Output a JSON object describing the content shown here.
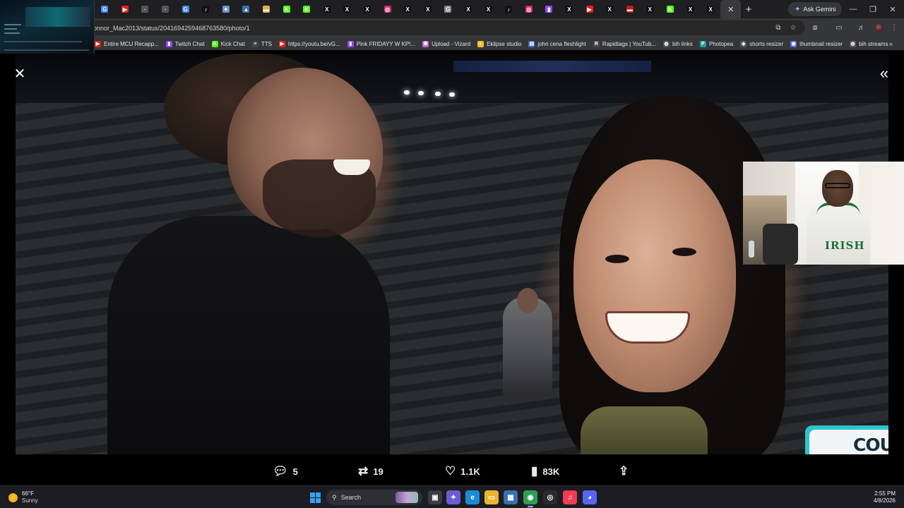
{
  "browser": {
    "tabs": [
      {
        "icon": "chrome-icon",
        "color": "#4285f4",
        "glyph": "G"
      },
      {
        "icon": "youtube-icon",
        "color": "#e62117",
        "glyph": "▶"
      },
      {
        "icon": "tab-icon",
        "color": "#555",
        "glyph": "·"
      },
      {
        "icon": "tab-icon",
        "color": "#555",
        "glyph": "·"
      },
      {
        "icon": "chrome-icon",
        "color": "#4285f4",
        "glyph": "G"
      },
      {
        "icon": "tiktok-icon",
        "color": "#111",
        "glyph": "♪"
      },
      {
        "icon": "twitch-icon",
        "color": "#6e8fd8",
        "glyph": "✦"
      },
      {
        "icon": "tab-icon",
        "color": "#3a6fb0",
        "glyph": "▲"
      },
      {
        "icon": "tab-icon",
        "color": "#d9b24a",
        "glyph": "▬"
      },
      {
        "icon": "kick-icon",
        "color": "#53fc18",
        "glyph": "K"
      },
      {
        "icon": "kick-icon",
        "color": "#53fc18",
        "glyph": "K"
      },
      {
        "icon": "x-icon",
        "color": "#111",
        "glyph": "X"
      },
      {
        "icon": "x-icon",
        "color": "#111",
        "glyph": "X"
      },
      {
        "icon": "x-icon",
        "color": "#111",
        "glyph": "X"
      },
      {
        "icon": "instagram-icon",
        "color": "#d62976",
        "glyph": "◎"
      },
      {
        "icon": "x-icon",
        "color": "#111",
        "glyph": "X"
      },
      {
        "icon": "x-icon",
        "color": "#111",
        "glyph": "X"
      },
      {
        "icon": "chrome-icon",
        "color": "#888",
        "glyph": "G"
      },
      {
        "icon": "x-icon",
        "color": "#111",
        "glyph": "X"
      },
      {
        "icon": "x-icon",
        "color": "#111",
        "glyph": "X"
      },
      {
        "icon": "tiktok-icon",
        "color": "#111",
        "glyph": "♪"
      },
      {
        "icon": "instagram-icon",
        "color": "#d62976",
        "glyph": "◎"
      },
      {
        "icon": "twitch-icon",
        "color": "#9146ff",
        "glyph": "▮"
      },
      {
        "icon": "x-icon",
        "color": "#111",
        "glyph": "X"
      },
      {
        "icon": "youtube-icon",
        "color": "#e62117",
        "glyph": "▶"
      },
      {
        "icon": "x-icon",
        "color": "#111",
        "glyph": "X"
      },
      {
        "icon": "tab-icon",
        "color": "#c4161c",
        "glyph": "▬"
      },
      {
        "icon": "x-icon",
        "color": "#111",
        "glyph": "X"
      },
      {
        "icon": "kick-icon",
        "color": "#53fc18",
        "glyph": "K"
      },
      {
        "icon": "x-icon",
        "color": "#111",
        "glyph": "X"
      },
      {
        "icon": "x-icon",
        "color": "#111",
        "glyph": "X"
      }
    ],
    "active_tab_close": "✕",
    "new_tab": "+",
    "gemini_label": "Ask Gemini",
    "window_controls": {
      "minimize": "—",
      "maximize": "❐",
      "close": "✕"
    },
    "url": "onnor_Mac2013/status/2041694259468763580/photo/1",
    "bookmarks": [
      {
        "label": "Entire MCU Recapp...",
        "icon": "youtube-icon",
        "color": "#e62117",
        "glyph": "▶"
      },
      {
        "label": "Twitch Chat",
        "icon": "twitch-icon",
        "color": "#9146ff",
        "glyph": "▮"
      },
      {
        "label": "Kick Chat",
        "icon": "kick-icon",
        "color": "#53fc18",
        "glyph": "K"
      },
      {
        "label": "TTS",
        "icon": "tts-icon",
        "color": "#444",
        "glyph": "≡"
      },
      {
        "label": "https://youtu.be/vG...",
        "icon": "youtube-icon",
        "color": "#e62117",
        "glyph": "▶"
      },
      {
        "label": "Pink FRIDAYY W KP!...",
        "icon": "twitch-icon",
        "color": "#9146ff",
        "glyph": "▮"
      },
      {
        "label": "Upload - Vizard",
        "icon": "vizard-icon",
        "color": "#c36cd8",
        "glyph": "✺"
      },
      {
        "label": "Eklipse studio",
        "icon": "eklipse-icon",
        "color": "#f2c230",
        "glyph": "◐"
      },
      {
        "label": "john cena fleshlight",
        "icon": "docs-icon",
        "color": "#3b6fd8",
        "glyph": "▤"
      },
      {
        "label": "Rapidtags | YouTub...",
        "icon": "rapidtags-icon",
        "color": "#444",
        "glyph": "R"
      },
      {
        "label": "bih links",
        "icon": "globe-icon",
        "color": "#555",
        "glyph": "◍"
      },
      {
        "label": "Photopea",
        "icon": "photopea-icon",
        "color": "#18a497",
        "glyph": "P"
      },
      {
        "label": "shorts resizer",
        "icon": "shorts-icon",
        "color": "#555",
        "glyph": "◈"
      },
      {
        "label": "thumbnail resizer",
        "icon": "thumbnail-icon",
        "color": "#5b6fd8",
        "glyph": "◉"
      },
      {
        "label": "bih streams",
        "icon": "streams-icon",
        "color": "#555",
        "glyph": "◍"
      }
    ],
    "bookmarks_more": "»"
  },
  "viewer": {
    "close_glyph": "✕",
    "collapse_glyph": "«",
    "overlay_badge_text": "COU",
    "webcam_shirt_text": "IRISH",
    "actions": {
      "replies": "5",
      "reposts": "19",
      "likes": "1.1K",
      "views": "83K"
    }
  },
  "taskbar": {
    "weather_temp": "66°F",
    "weather_condition": "Sunny",
    "search_label": "Search",
    "time": "2:55 PM",
    "date": "4/8/2026",
    "apps": [
      {
        "name": "taskview-icon",
        "color": "#3a3b40",
        "glyph": "▣"
      },
      {
        "name": "copilot-icon",
        "color": "#6b5cd6",
        "glyph": "✦"
      },
      {
        "name": "edge-icon",
        "color": "#1b8bd6",
        "glyph": "e"
      },
      {
        "name": "file-explorer-icon",
        "color": "#e9b430",
        "glyph": "▭"
      },
      {
        "name": "store-icon",
        "color": "#3a6fb0",
        "glyph": "▦"
      },
      {
        "name": "chrome-icon",
        "color": "#2f9e55",
        "glyph": "◉"
      },
      {
        "name": "obs-icon",
        "color": "#2b2b2b",
        "glyph": "◎"
      },
      {
        "name": "music-icon",
        "color": "#f23b55",
        "glyph": "♫"
      },
      {
        "name": "discord-icon",
        "color": "#5865f2",
        "glyph": "◕"
      }
    ]
  }
}
